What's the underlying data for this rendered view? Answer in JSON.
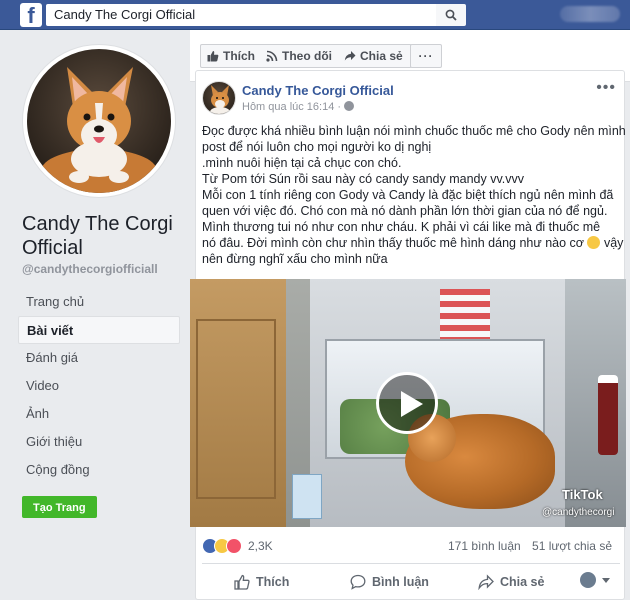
{
  "topbar": {
    "logo": "f",
    "search_value": "Candy The Corgi Official"
  },
  "page": {
    "name": "Candy The Corgi Official",
    "handle": "@candythecorgiofficiall",
    "nav": [
      {
        "label": "Trang chủ",
        "active": false
      },
      {
        "label": "Bài viết",
        "active": true
      },
      {
        "label": "Đánh giá",
        "active": false
      },
      {
        "label": "Video",
        "active": false
      },
      {
        "label": "Ảnh",
        "active": false
      },
      {
        "label": "Giới thiệu",
        "active": false
      },
      {
        "label": "Cộng đồng",
        "active": false
      }
    ],
    "create_page_label": "Tạo Trang"
  },
  "action_bar": {
    "like_label": "Thích",
    "follow_label": "Theo dõi",
    "share_label": "Chia sẻ",
    "more_label": "···"
  },
  "post": {
    "author": "Candy The Corgi Official",
    "time": "Hôm qua lúc 16:14 ·",
    "more_label": "•••",
    "lines": [
      "Đọc được khá nhiều bình luận nói mình chuốc thuốc mê cho Gody nên mình",
      "post để nói luôn cho mọi người ko dị nghị",
      ".mình nuôi hiện tại cả chục con chó.",
      "Từ Pom tới Sún rồi sau này có candy sandy mandy vv.vvv",
      "Mỗi con 1 tính riêng con Gody và Candy là đặc biệt thích ngủ nên mình đã",
      "quen với việc đó. Chó con mà nó dành phần lớn thời gian của nó để ngủ.",
      "Mình thương tui nó như con như cháu. K phải vì cái like mà đi thuốc mê",
      "nó đâu. Đời mình còn chư nhìn thấy thuốc mê hình dáng như nào cơ",
      "nên đừng nghĩ xấu cho mình nữa"
    ],
    "line8_tail": " vậy",
    "video": {
      "watermark": "TikTok",
      "handle": "@candythecorgi"
    },
    "reactions_count": "2,3K",
    "comments": "171 bình luận",
    "shares": "51 lượt chia sẻ",
    "like_label": "Thích",
    "comment_label": "Bình luận",
    "share_label": "Chia sẻ"
  },
  "colors": {
    "brand": "#3b5998",
    "link": "#365899",
    "create_button": "#42b72a"
  }
}
